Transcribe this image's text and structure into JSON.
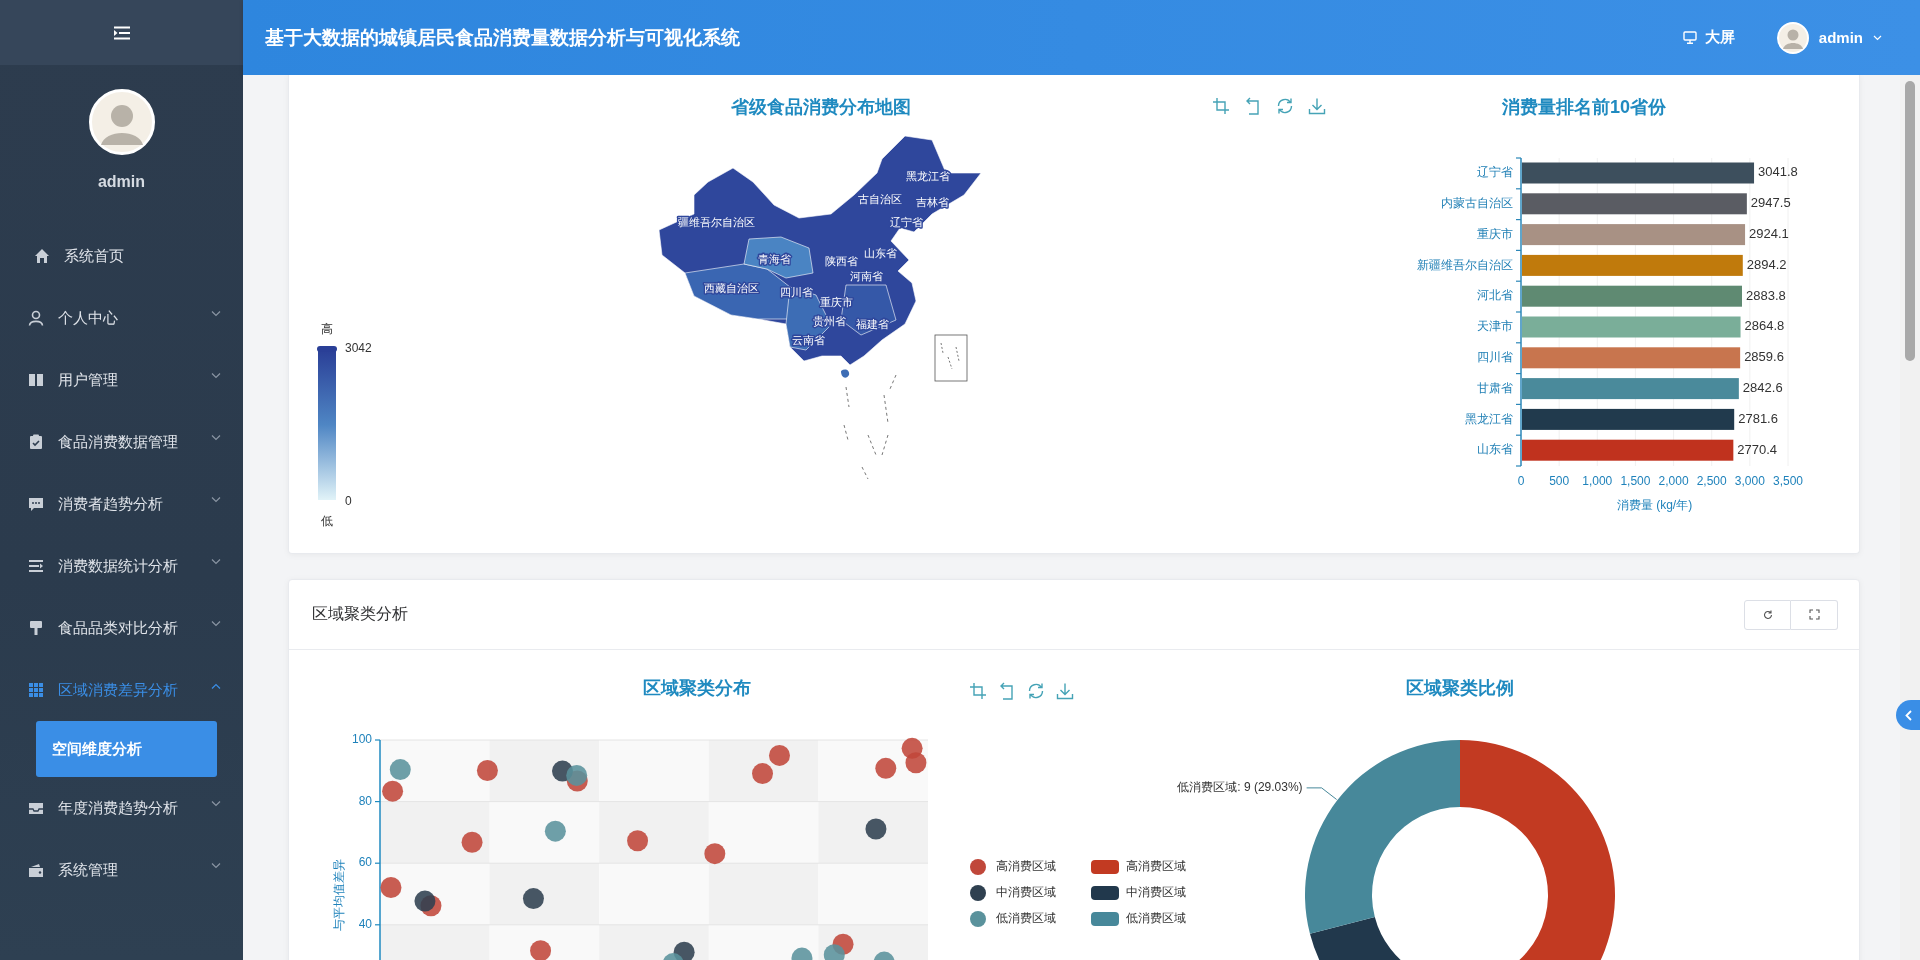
{
  "sidebar": {
    "username": "admin",
    "items": [
      {
        "kind": "link",
        "label": "系统首页"
      },
      {
        "kind": "submenu",
        "label": "个人中心",
        "expanded": false
      },
      {
        "kind": "submenu",
        "label": "用户管理",
        "expanded": false
      },
      {
        "kind": "submenu",
        "label": "食品消费数据管理",
        "expanded": false
      },
      {
        "kind": "submenu",
        "label": "消费者趋势分析",
        "expanded": false
      },
      {
        "kind": "submenu",
        "label": "消费数据统计分析",
        "expanded": false
      },
      {
        "kind": "submenu",
        "label": "食品品类对比分析",
        "expanded": false
      },
      {
        "kind": "submenu",
        "label": "区域消费差异分析",
        "expanded": true,
        "children": [
          {
            "label": "空间维度分析",
            "selected": true
          }
        ]
      },
      {
        "kind": "submenu",
        "label": "年度消费趋势分析",
        "expanded": false
      },
      {
        "kind": "submenu",
        "label": "系统管理",
        "expanded": false
      }
    ]
  },
  "header": {
    "title": "基于大数据的城镇居民食品消费量数据分析与可视化系统",
    "screen_button": "大屏",
    "user": "admin"
  },
  "map_panel": {
    "title": "省级食品消费分布地图",
    "scale": {
      "high_label": "高",
      "max": "3042",
      "min": "0",
      "low_label": "低"
    },
    "region_labels": [
      "黑龙江省",
      "吉林省",
      "古自治区",
      "辽宁省",
      "疆维吾尔自治区",
      "青海省",
      "陕西省",
      "河南省",
      "山东省",
      "西藏自治区",
      "四川省",
      "重庆市",
      "贵州省",
      "云南省",
      "福建省"
    ]
  },
  "bar_panel": {
    "chart_data": {
      "type": "bar",
      "orientation": "horizontal",
      "title": "消费量排名前10省份",
      "xlabel": "消费量 (kg/年)",
      "categories": [
        "辽宁省",
        "内蒙古自治区",
        "重庆市",
        "新疆维吾尔自治区",
        "河北省",
        "天津市",
        "四川省",
        "甘肃省",
        "黑龙江省",
        "山东省"
      ],
      "values": [
        3041.8,
        2947.5,
        2924.1,
        2894.2,
        2883.8,
        2864.8,
        2859.6,
        2842.6,
        2781.6,
        2770.4
      ],
      "colors": [
        "#3d4f5d",
        "#5a5c63",
        "#a89184",
        "#c07a0c",
        "#5f8a72",
        "#7aae99",
        "#c8754e",
        "#4a8a9b",
        "#213a4d",
        "#c0321e"
      ],
      "value_labels": [
        "3041.8",
        "2947.5",
        "2924.1",
        "2894.2",
        "2883.8",
        "2864.8",
        "2859.6",
        "2842.6",
        "2781.6",
        "2770.4"
      ],
      "xlim": [
        0,
        3500
      ],
      "grid": true,
      "xticks": [
        {
          "value": 0,
          "label": "0"
        },
        {
          "value": 500,
          "label": "500"
        },
        {
          "value": 1000,
          "label": "1,000"
        },
        {
          "value": 1500,
          "label": "1,500"
        },
        {
          "value": 2000,
          "label": "2,000"
        },
        {
          "value": 2500,
          "label": "2,500"
        },
        {
          "value": 3000,
          "label": "3,000"
        },
        {
          "value": 3500,
          "label": "3,500"
        }
      ]
    }
  },
  "cluster_card": {
    "title": "区域聚类分析",
    "scatter": {
      "title": "区域聚类分布",
      "ylabel": "与平均值差异",
      "y_tick_labels": [
        "100",
        "80",
        "60",
        "40"
      ],
      "legend": [
        {
          "label": "高消费区域",
          "color": "#c0473a"
        },
        {
          "label": "中消费区域",
          "color": "#2f4050"
        },
        {
          "label": "低消费区域",
          "color": "#5a929c"
        }
      ]
    },
    "donut": {
      "chart_data": {
        "type": "donut",
        "title": "区域聚类比例",
        "legend": "left",
        "categories": [
          "高消费区域",
          "中消费区域",
          "低消费区域"
        ],
        "values": [
          18,
          4,
          9
        ],
        "colors": [
          "#c23a22",
          "#21384c",
          "#47889a"
        ],
        "value_labels": [
          null,
          null,
          "低消费区域: 9 (29.03%)"
        ]
      }
    }
  }
}
